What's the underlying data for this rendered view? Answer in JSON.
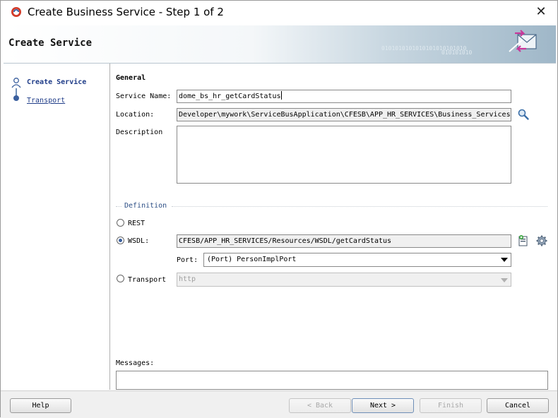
{
  "window": {
    "title": "Create Business Service - Step 1 of 2",
    "close_glyph": "✕"
  },
  "banner": {
    "title": "Create Service",
    "binary_1": "0101010101010101010101010",
    "binary_2": "010101010"
  },
  "nav": {
    "items": [
      {
        "label": "Create Service",
        "active": true
      },
      {
        "label": "Transport",
        "active": false
      }
    ]
  },
  "general": {
    "section_title": "General",
    "service_name_label": "Service Name:",
    "service_name_value": "dome_bs_hr_getCardStatus",
    "location_label": "Location:",
    "location_value": "Developer\\mywork\\ServiceBusApplication\\CFESB\\APP_HR_SERVICES\\Business_Services",
    "description_label": "Description",
    "description_value": ""
  },
  "definition": {
    "section_title": "Definition",
    "rest_label": "REST",
    "wsdl_label": "WSDL:",
    "wsdl_value": "CFESB/APP_HR_SERVICES/Resources/WSDL/getCardStatus",
    "port_label": "Port:",
    "port_value": "(Port) PersonImplPort",
    "transport_label": "Transport",
    "transport_value": "http",
    "selected": "WSDL"
  },
  "messages": {
    "label": "Messages:",
    "value": ""
  },
  "buttons": {
    "help": "Help",
    "back": "< Back",
    "next": "Next >",
    "finish": "Finish",
    "cancel": "Cancel"
  },
  "icons": {
    "app": "oracle-app-icon",
    "search": "magnifier-icon",
    "wsdl_browse": "wsdl-browse-icon",
    "wsdl_gear": "gear-icon",
    "banner": "envelope-arrows-icon"
  },
  "colors": {
    "radio_selected": "#3a5f9e",
    "link": "#1f3c88"
  }
}
